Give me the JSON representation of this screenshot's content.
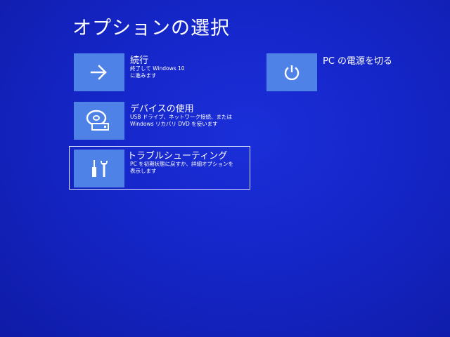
{
  "page": {
    "title": "オプションの選択"
  },
  "options": [
    {
      "title": "続行",
      "description": "終了して Windows 10\nに進みます",
      "icon": "arrow-right-icon"
    },
    {
      "title": "デバイスの使用",
      "description": "USB ドライブ、ネットワーク接続、または\nWindows リカバリ DVD を使います",
      "icon": "disc-drive-icon"
    },
    {
      "title": "トラブルシューティング",
      "description": "PC を初期状態に戻すか、詳細オプションを\n表示します",
      "icon": "tools-icon",
      "selected": true
    },
    {
      "title": "PC の電源を切る",
      "description": "",
      "icon": "power-icon"
    }
  ],
  "colors": {
    "background": "#1526c8",
    "tile": "#4f82e6",
    "text": "#ffffff",
    "selection_border": "#dbe3ff"
  }
}
